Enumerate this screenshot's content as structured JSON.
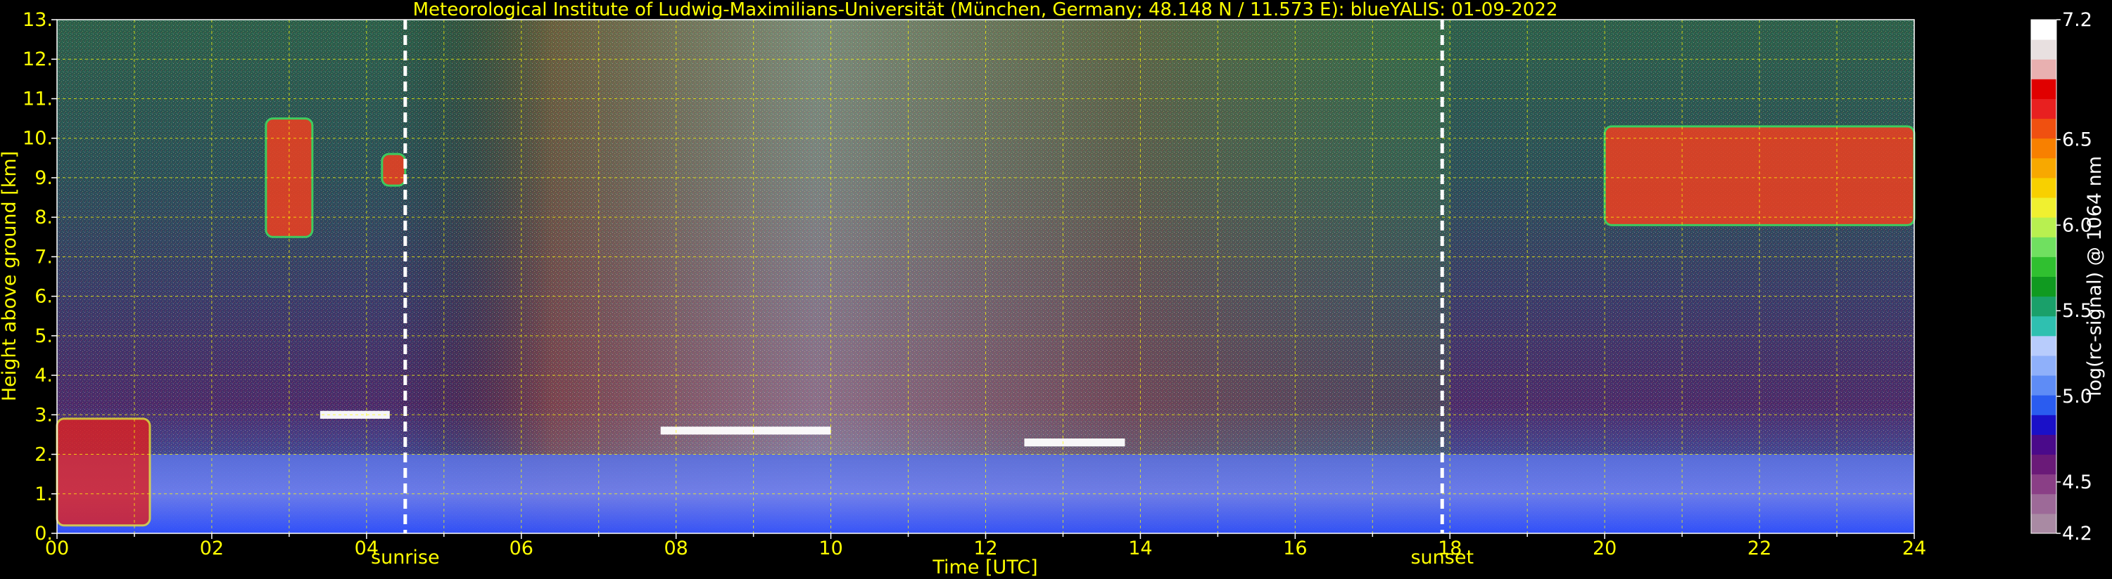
{
  "chart_data": {
    "type": "heatmap",
    "title": "Meteorological Institute of Ludwig-Maximilians-Universität (München, Germany; 48.148 N / 11.573 E):    blueYALIS: 01-09-2022",
    "xlabel": "Time [UTC]",
    "ylabel": "Height above ground [km]",
    "xlim": [
      0,
      24
    ],
    "ylim": [
      0,
      13
    ],
    "xtick_labels": [
      "00",
      "02",
      "04",
      "06",
      "08",
      "10",
      "12",
      "14",
      "16",
      "18",
      "20",
      "22",
      "24"
    ],
    "ytick_labels": [
      "0.",
      "1.",
      "2.",
      "3.",
      "4.",
      "5.",
      "6.",
      "7.",
      "8.",
      "9.",
      "10.",
      "11.",
      "12.",
      "13."
    ],
    "grid": true,
    "sun_events": [
      {
        "label": "sunrise",
        "time_utc": 4.5
      },
      {
        "label": "sunset",
        "time_utc": 17.9
      }
    ],
    "colorbar": {
      "label": "log(rc-signal) @ 1064 nm",
      "range": [
        4.2,
        7.2
      ],
      "tick_labels": [
        "7.2",
        "6.5",
        "6.0",
        "5.5",
        "5.0",
        "4.5",
        "4.2"
      ],
      "colors": [
        "#a98aa3",
        "#9d6a98",
        "#8a3f86",
        "#6a1a78",
        "#4a0a8a",
        "#1a10c8",
        "#2a5cf0",
        "#5e8cf6",
        "#8fb0fa",
        "#b8ccfc",
        "#2fc0b0",
        "#1aa06a",
        "#109a20",
        "#30c030",
        "#70e060",
        "#b8f050",
        "#f0f030",
        "#f8d000",
        "#f8a800",
        "#f88000",
        "#f05010",
        "#e82020",
        "#e00000",
        "#e8b0b0",
        "#e8e0e0",
        "#ffffff"
      ]
    },
    "features": [
      {
        "type": "boundary layer aerosol",
        "x_range": [
          0,
          24
        ],
        "top_km_approx": 2.0
      },
      {
        "type": "cirrus cloud",
        "x_range": [
          2.7,
          3.3
        ],
        "y_range_km": [
          7.5,
          10.5
        ]
      },
      {
        "type": "cirrus cloud",
        "x_range": [
          4.2,
          4.5
        ],
        "y_range_km": [
          8.8,
          9.6
        ]
      },
      {
        "type": "cirrus cloud",
        "x_range": [
          20.0,
          24
        ],
        "y_range_km": [
          7.8,
          10.3
        ]
      },
      {
        "type": "low cloud",
        "x_range": [
          0,
          1.2
        ],
        "y_range_km": [
          0.2,
          2.9
        ]
      },
      {
        "type": "cloud layer",
        "x_range": [
          3.4,
          4.3
        ],
        "y_range_km": [
          2.9,
          3.1
        ]
      },
      {
        "type": "cloud layer",
        "x_range": [
          7.8,
          10.0
        ],
        "y_range_km": [
          2.5,
          2.7
        ]
      },
      {
        "type": "cloud layer",
        "x_range": [
          12.5,
          13.8
        ],
        "y_range_km": [
          2.2,
          2.4
        ]
      }
    ]
  }
}
